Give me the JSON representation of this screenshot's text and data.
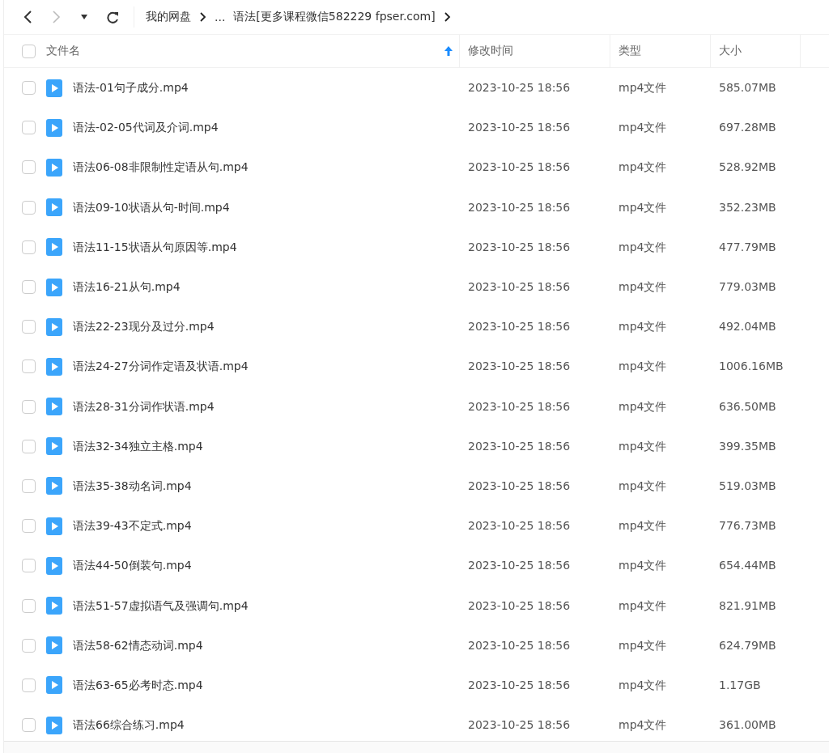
{
  "toolbar": {
    "breadcrumbs": [
      {
        "label": "我的网盘"
      },
      {
        "label": "..."
      },
      {
        "label": "语法[更多课程微信582229 fpser.com]"
      }
    ]
  },
  "table": {
    "select_all": {
      "checked": false
    },
    "columns": [
      {
        "label": "文件名",
        "sorted": true
      },
      {
        "label": "修改时间",
        "sorted": false
      },
      {
        "label": "类型",
        "sorted": false
      },
      {
        "label": "大小",
        "sorted": false
      }
    ],
    "rows": [
      {
        "name": "语法-01句子成分.mp4",
        "modified": "2023-10-25 18:56",
        "type": "mp4文件",
        "size": "585.07MB",
        "checked": false
      },
      {
        "name": "语法-02-05代词及介词.mp4",
        "modified": "2023-10-25 18:56",
        "type": "mp4文件",
        "size": "697.28MB",
        "checked": false
      },
      {
        "name": "语法06-08非限制性定语从句.mp4",
        "modified": "2023-10-25 18:56",
        "type": "mp4文件",
        "size": "528.92MB",
        "checked": false
      },
      {
        "name": "语法09-10状语从句-时间.mp4",
        "modified": "2023-10-25 18:56",
        "type": "mp4文件",
        "size": "352.23MB",
        "checked": false
      },
      {
        "name": "语法11-15状语从句原因等.mp4",
        "modified": "2023-10-25 18:56",
        "type": "mp4文件",
        "size": "477.79MB",
        "checked": false
      },
      {
        "name": "语法16-21从句.mp4",
        "modified": "2023-10-25 18:56",
        "type": "mp4文件",
        "size": "779.03MB",
        "checked": false
      },
      {
        "name": "语法22-23现分及过分.mp4",
        "modified": "2023-10-25 18:56",
        "type": "mp4文件",
        "size": "492.04MB",
        "checked": false
      },
      {
        "name": "语法24-27分词作定语及状语.mp4",
        "modified": "2023-10-25 18:56",
        "type": "mp4文件",
        "size": "1006.16MB",
        "checked": false
      },
      {
        "name": "语法28-31分词作状语.mp4",
        "modified": "2023-10-25 18:56",
        "type": "mp4文件",
        "size": "636.50MB",
        "checked": false
      },
      {
        "name": "语法32-34独立主格.mp4",
        "modified": "2023-10-25 18:56",
        "type": "mp4文件",
        "size": "399.35MB",
        "checked": false
      },
      {
        "name": "语法35-38动名词.mp4",
        "modified": "2023-10-25 18:56",
        "type": "mp4文件",
        "size": "519.03MB",
        "checked": false
      },
      {
        "name": "语法39-43不定式.mp4",
        "modified": "2023-10-25 18:56",
        "type": "mp4文件",
        "size": "776.73MB",
        "checked": false
      },
      {
        "name": "语法44-50倒装句.mp4",
        "modified": "2023-10-25 18:56",
        "type": "mp4文件",
        "size": "654.44MB",
        "checked": false
      },
      {
        "name": "语法51-57虚拟语气及强调句.mp4",
        "modified": "2023-10-25 18:56",
        "type": "mp4文件",
        "size": "821.91MB",
        "checked": false
      },
      {
        "name": "语法58-62情态动词.mp4",
        "modified": "2023-10-25 18:56",
        "type": "mp4文件",
        "size": "624.79MB",
        "checked": false
      },
      {
        "name": "语法63-65必考时态.mp4",
        "modified": "2023-10-25 18:56",
        "type": "mp4文件",
        "size": "1.17GB",
        "checked": false
      },
      {
        "name": "语法66综合练习.mp4",
        "modified": "2023-10-25 18:56",
        "type": "mp4文件",
        "size": "361.00MB",
        "checked": false
      }
    ]
  }
}
